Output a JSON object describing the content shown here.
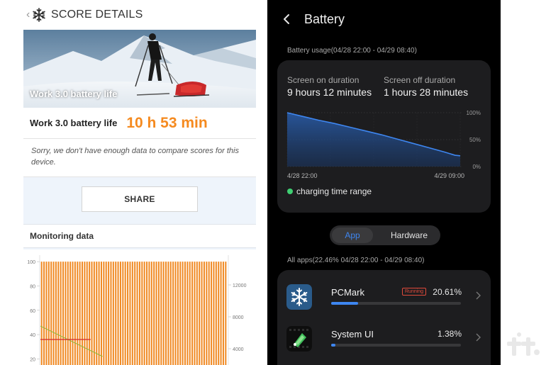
{
  "left": {
    "header": {
      "title": "SCORE DETAILS",
      "back_icon": "‹",
      "logo_icon": "snowflake-icon"
    },
    "hero": {
      "label": "Work 3.0 battery life",
      "badge": "3.0"
    },
    "score": {
      "label": "Work 3.0 battery life",
      "value": "10 h 53 min",
      "value_color": "#f58a1f"
    },
    "notice": "Sorry, we don't have enough data to compare scores for this device.",
    "share_label": "SHARE",
    "monitoring_title": "Monitoring data",
    "chart_data": {
      "type": "bar",
      "title": "",
      "left_axis_ticks": [
        "100",
        "80",
        "60",
        "40",
        "20"
      ],
      "right_axis_ticks": [
        "12000",
        "8000",
        "4000"
      ],
      "ylim": [
        15,
        103
      ],
      "bar_count": 78,
      "series": [
        {
          "values": [
            100,
            100,
            100,
            100,
            100,
            100,
            100,
            100,
            100,
            100,
            100,
            100,
            100,
            100,
            100,
            100,
            100,
            100,
            100,
            100,
            100,
            100,
            100,
            100,
            100,
            100,
            100,
            100,
            100,
            100,
            100,
            100,
            100,
            100,
            100,
            100,
            100,
            100,
            100,
            100,
            100,
            100,
            100,
            100,
            100,
            100,
            100,
            100,
            100,
            100,
            100,
            100,
            100,
            100,
            100,
            100,
            100,
            100,
            100,
            100,
            100,
            100,
            100,
            100,
            100,
            100,
            100,
            100,
            100,
            100,
            100,
            100,
            100,
            100,
            100,
            100,
            100,
            100
          ],
          "color": "#f08a24"
        },
        {
          "color": "#8fb83a",
          "points": [
            [
              0,
              47
            ],
            [
              26,
              22
            ]
          ]
        },
        {
          "color": "#d42a2a",
          "points": [
            [
              0,
              36
            ],
            [
              21,
              36
            ]
          ]
        }
      ]
    }
  },
  "right": {
    "header": {
      "title": "Battery",
      "back_icon": "chevron-left-icon"
    },
    "usage_label": "Battery usage(04/28 22:00 - 04/29 08:40)",
    "screen_on": {
      "label": "Screen on duration",
      "value": "9 hours 12 minutes"
    },
    "screen_off": {
      "label": "Screen off duration",
      "value": "1 hours 28 minutes"
    },
    "chart_data": {
      "type": "area",
      "x_labels": [
        "4/28 22:00",
        "4/29 09:00"
      ],
      "y_ticks": [
        "100%",
        "50%",
        "0%"
      ],
      "ylim": [
        0,
        100
      ],
      "series": [
        {
          "x": [
            0,
            1,
            2,
            3,
            4,
            5,
            6,
            7,
            8,
            9,
            10,
            10.67,
            11
          ],
          "values": [
            100,
            93,
            86,
            80,
            73,
            66,
            59,
            51,
            43,
            35,
            27,
            21,
            20
          ],
          "color": "#3e86f0"
        }
      ]
    },
    "legend_label": "charging time range",
    "legend_color": "#3fcf72",
    "tabs": {
      "app": "App",
      "hardware": "Hardware"
    },
    "all_apps_label": "All apps(22.46% 04/28 22:00 - 04/29 08:40)",
    "apps": [
      {
        "name": "PCMark",
        "badge": "Running",
        "percent": "20.61%",
        "fraction": 0.2061,
        "icon": "snowflake-icon"
      },
      {
        "name": "System UI",
        "percent": "1.38%",
        "fraction": 0.0138,
        "icon": "android-icon"
      }
    ],
    "accent": "#3e86f0"
  },
  "watermark": "tt"
}
